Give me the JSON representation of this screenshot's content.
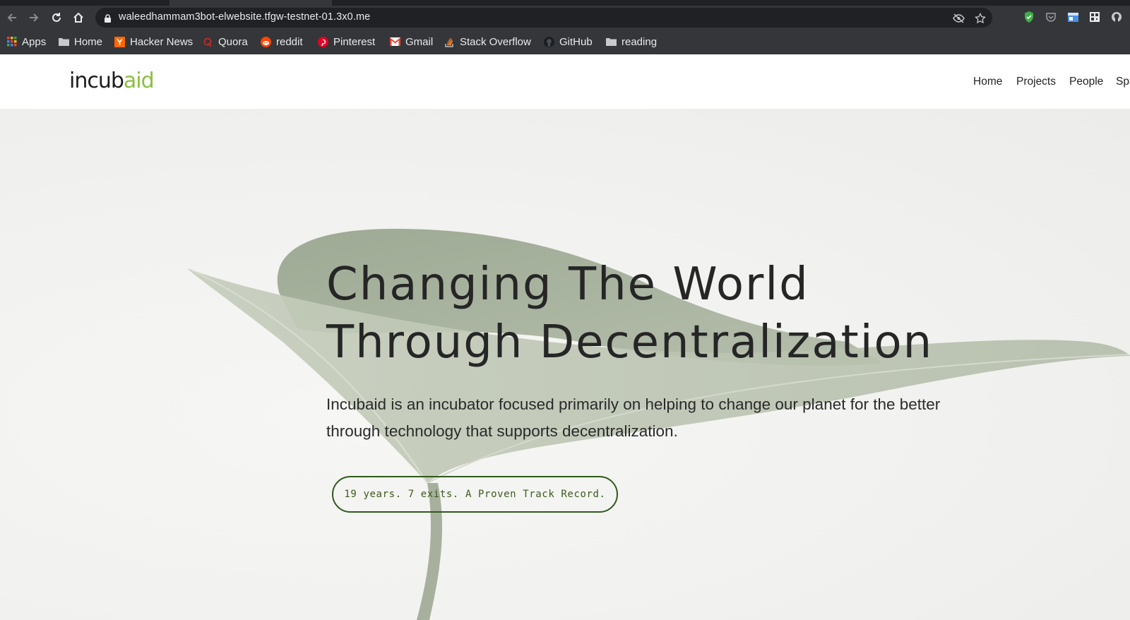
{
  "browser": {
    "url": "waleedhammam3bot-elwebsite.tfgw-testnet-01.3x0.me",
    "icons": [
      "back-icon",
      "forward-icon",
      "reload-icon",
      "home-icon",
      "lock-icon",
      "eye-off-icon",
      "star-icon"
    ],
    "extensions": [
      "shield-extension-icon",
      "pocket-extension-icon",
      "window-extension-icon",
      "qr-extension-icon",
      "github-extension-icon"
    ]
  },
  "bookmarks": [
    {
      "label": "Apps",
      "icon": "apps-grid-icon"
    },
    {
      "label": "Home",
      "icon": "folder-icon"
    },
    {
      "label": "Hacker News",
      "icon": "hacker-news-icon"
    },
    {
      "label": "Quora",
      "icon": "quora-icon"
    },
    {
      "label": "reddit",
      "icon": "reddit-icon"
    },
    {
      "label": "Pinterest",
      "icon": "pinterest-icon"
    },
    {
      "label": "Gmail",
      "icon": "gmail-icon"
    },
    {
      "label": "Stack Overflow",
      "icon": "stack-overflow-icon"
    },
    {
      "label": "GitHub",
      "icon": "github-icon"
    },
    {
      "label": "reading",
      "icon": "folder-icon"
    }
  ],
  "site": {
    "logo_part1": "incub",
    "logo_part2": "aid",
    "nav": [
      "Home",
      "Projects",
      "People",
      "Spa"
    ],
    "headline_line1": "Changing The World",
    "headline_line2": "Through Decentralization",
    "subtext": "Incubaid is an incubator focused primarily on helping to change our planet for the better through technology that supports decentralization.",
    "cta": "19 years. 7 exits. A Proven Track Record."
  },
  "colors": {
    "chrome_bg": "#35363a",
    "omnibox_bg": "#202124",
    "logo_green": "#8cbf3f",
    "cta_border": "#2f5a1c",
    "leaf": "#8a9a7e"
  }
}
